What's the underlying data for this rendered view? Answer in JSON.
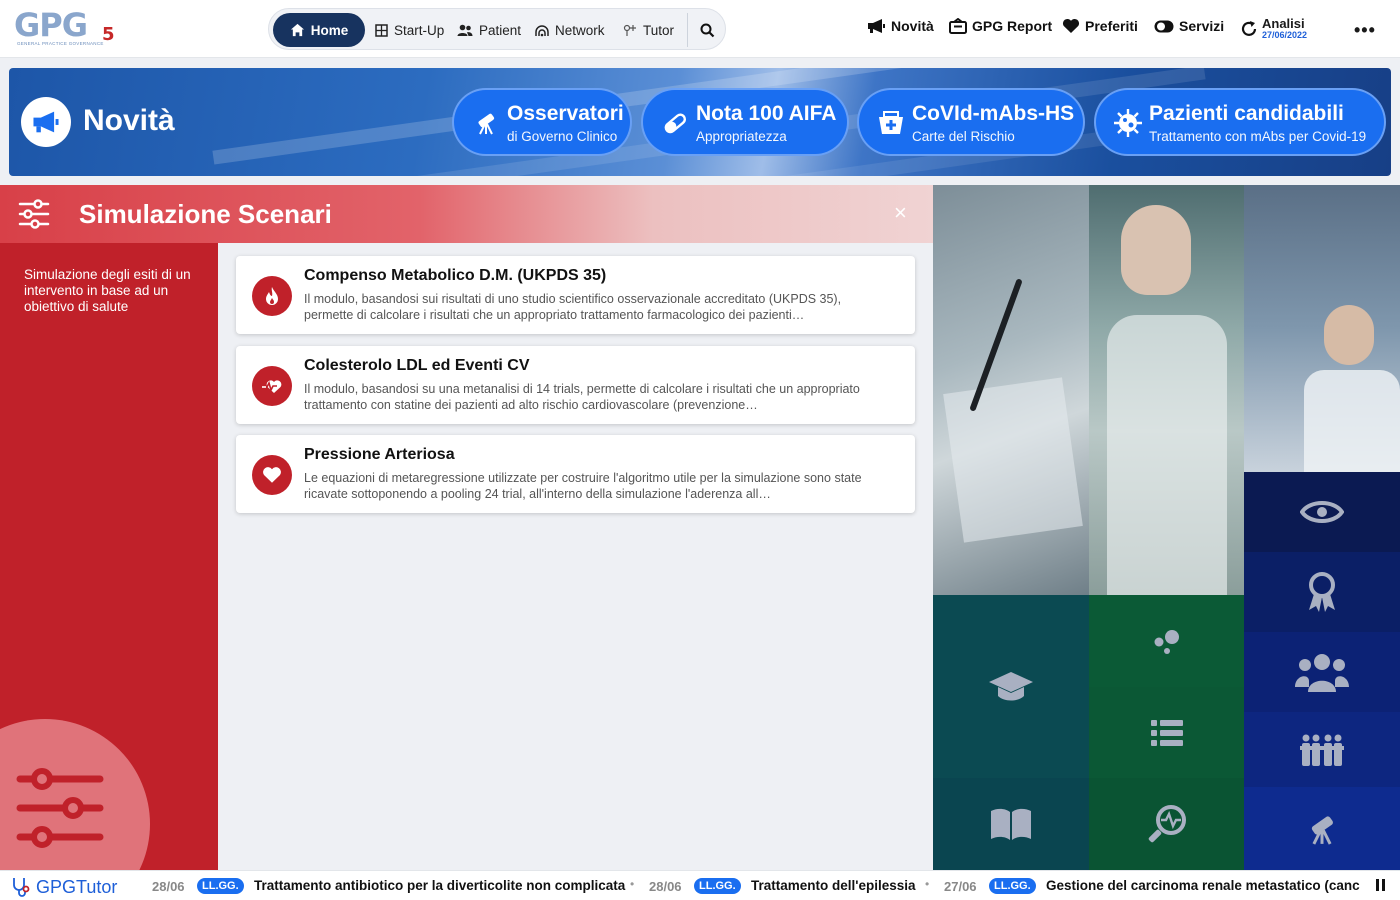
{
  "topbar": {
    "logo": {
      "text": "GPG",
      "sub": "GENERAL PRACTICE GOVERNANCE",
      "num": "5"
    },
    "nav": [
      {
        "label": "Home",
        "icon": "home-icon"
      },
      {
        "label": "Start-Up",
        "icon": "grid-icon"
      },
      {
        "label": "Patient",
        "icon": "users-icon"
      },
      {
        "label": "Network",
        "icon": "network-icon"
      },
      {
        "label": "Tutor",
        "icon": "tutor-icon"
      }
    ],
    "right": [
      {
        "label": "Novità",
        "icon": "megaphone-icon"
      },
      {
        "label": "GPG Report",
        "icon": "report-icon"
      },
      {
        "label": "Preferiti",
        "icon": "heart-icon"
      },
      {
        "label": "Servizi",
        "icon": "toggle-icon"
      }
    ],
    "analisi": {
      "label": "Analisi",
      "date": "27/06/2022"
    },
    "more": "•••"
  },
  "banner": {
    "title": "Novità",
    "pills": [
      {
        "title": "Osservatori",
        "subtitle": "di Governo Clinico",
        "icon": "telescope-icon"
      },
      {
        "title": "Nota 100 AIFA",
        "subtitle": "Appropriatezza",
        "icon": "pill-icon"
      },
      {
        "title": "CoVId-mAbs-HS",
        "subtitle": "Carte del Rischio",
        "icon": "medkit-icon"
      },
      {
        "title": "Pazienti candidabili",
        "subtitle": "Trattamento con mAbs per Covid-19",
        "icon": "virus-icon"
      }
    ]
  },
  "section": {
    "title": "Simulazione Scenari",
    "close": "×",
    "description": "Simulazione degli esiti di un intervento in base ad un obiettivo di salute"
  },
  "cards": [
    {
      "title": "Compenso Metabolico D.M. (UKPDS 35)",
      "text": "Il modulo, basandosi sui risultati di uno studio scientifico osservazionale accreditato (UKPDS 35), permette di calcolare i risultati che un appropriato trattamento farmacologico dei pazienti…",
      "icon": "flame-icon"
    },
    {
      "title": "Colesterolo LDL ed Eventi CV",
      "text": "Il modulo, basandosi su una metanalisi di 14 trials, permette di calcolare i risultati che un appropriato trattamento con statine dei pazienti ad alto rischio cardiovascolare (prevenzione…",
      "icon": "heart-pulse-icon"
    },
    {
      "title": "Pressione Arteriosa",
      "text": "Le equazioni di metaregressione utilizzate per costruire l'algoritmo utile per la simulazione sono state ricavate sottoponendo a pooling 24 trial, all'interno della simulazione l'aderenza all…",
      "icon": "heart-icon"
    }
  ],
  "ticker": {
    "brand": "GPGTutor",
    "items": [
      {
        "date": "28/06",
        "badge": "LL.GG.",
        "text": "Trattamento antibiotico per la diverticolite non complicata"
      },
      {
        "date": "28/06",
        "badge": "LL.GG.",
        "text": "Trattamento dell'epilessia"
      },
      {
        "date": "27/06",
        "badge": "LL.GG.",
        "text": "Gestione del carcinoma renale metastatico (cancro"
      }
    ],
    "separator": "•"
  },
  "colors": {
    "navy": "#17335f",
    "blue": "#1a6ef0",
    "red": "#c0212a"
  }
}
